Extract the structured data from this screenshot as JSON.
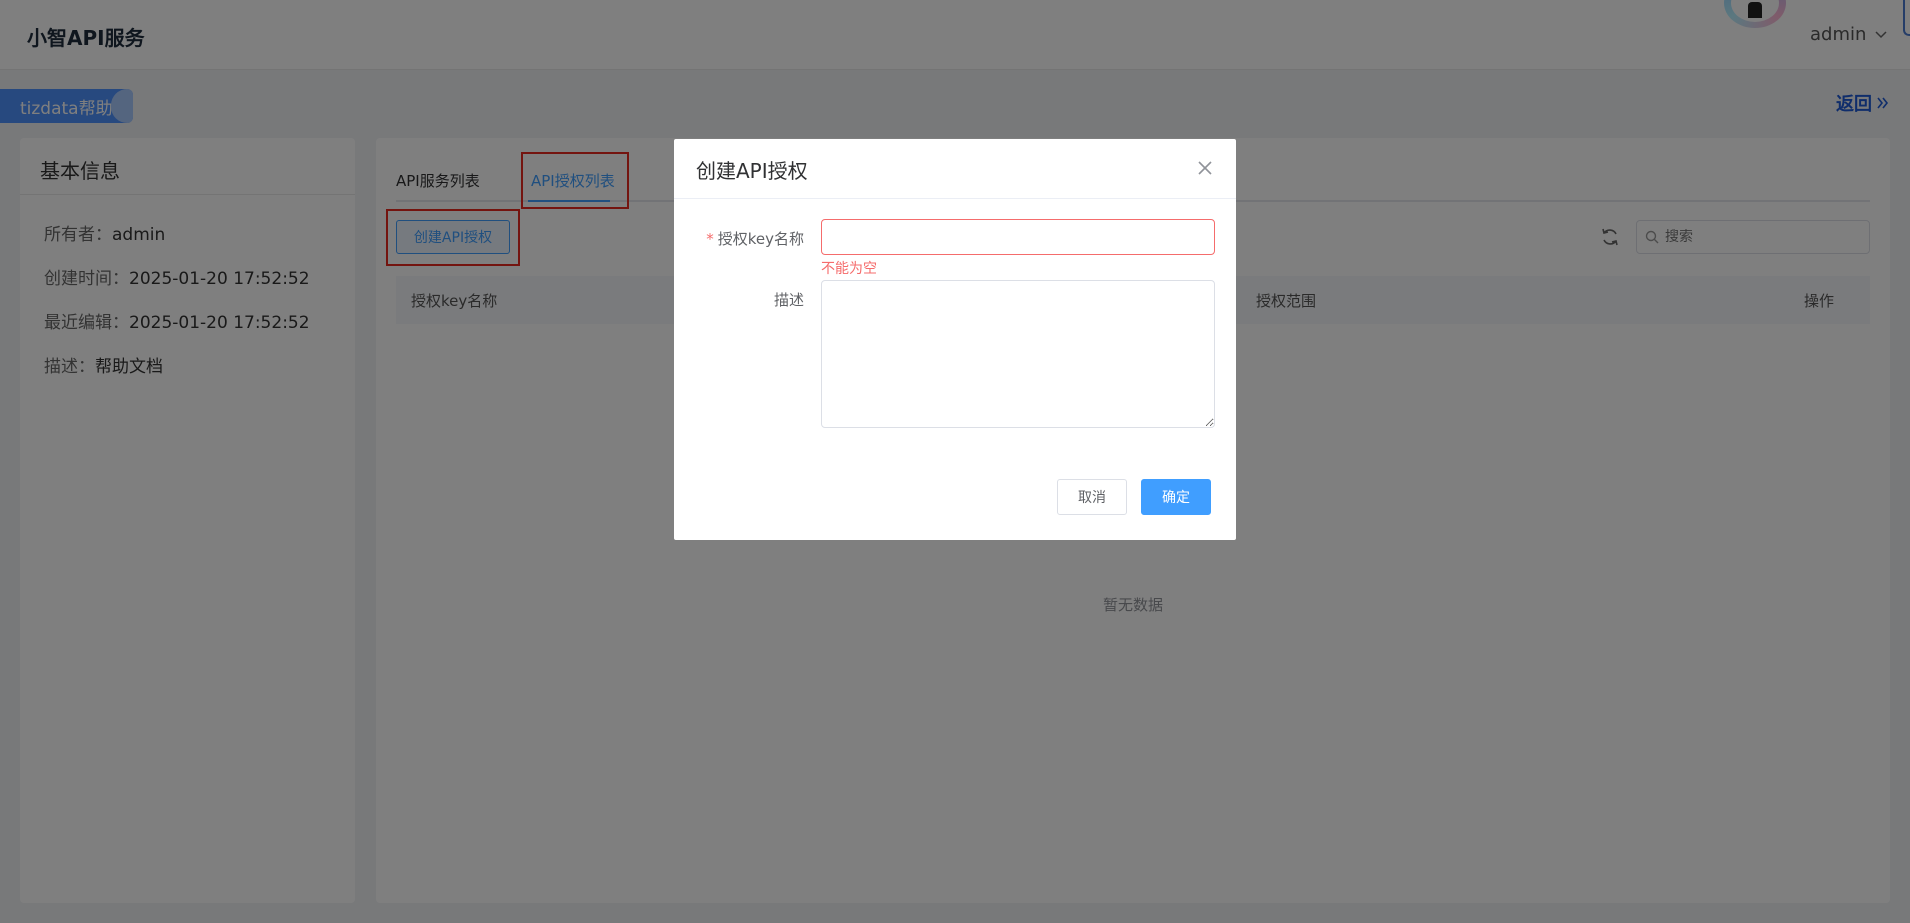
{
  "header": {
    "app_title": "小智API服务",
    "user_name": "admin",
    "help_badge": "tizdata帮助",
    "back_link": "返回"
  },
  "info": {
    "title": "基本信息",
    "rows": [
      {
        "label": "所有者：",
        "value": "admin"
      },
      {
        "label": "创建时间：",
        "value": "2025-01-20 17:52:52"
      },
      {
        "label": "最近编辑：",
        "value": "2025-01-20 17:52:52"
      },
      {
        "label": "描述：",
        "value": "帮助文档"
      }
    ]
  },
  "main": {
    "tabs": [
      {
        "label": "API服务列表",
        "active": false
      },
      {
        "label": "API授权列表",
        "active": true
      }
    ],
    "create_button": "创建API授权",
    "search_placeholder": "搜索",
    "columns": [
      "授权key名称",
      "授权范围",
      "操作"
    ],
    "empty_text": "暂无数据"
  },
  "dialog": {
    "title": "创建API授权",
    "fields": {
      "key_name_label": "授权key名称",
      "key_name_value": "",
      "key_name_error": "不能为空",
      "required_mark": "*",
      "description_label": "描述",
      "description_value": ""
    },
    "cancel_label": "取消",
    "ok_label": "确定"
  },
  "colors": {
    "primary": "#409eff",
    "error": "#f56c6c",
    "annotation": "#e8281e"
  }
}
